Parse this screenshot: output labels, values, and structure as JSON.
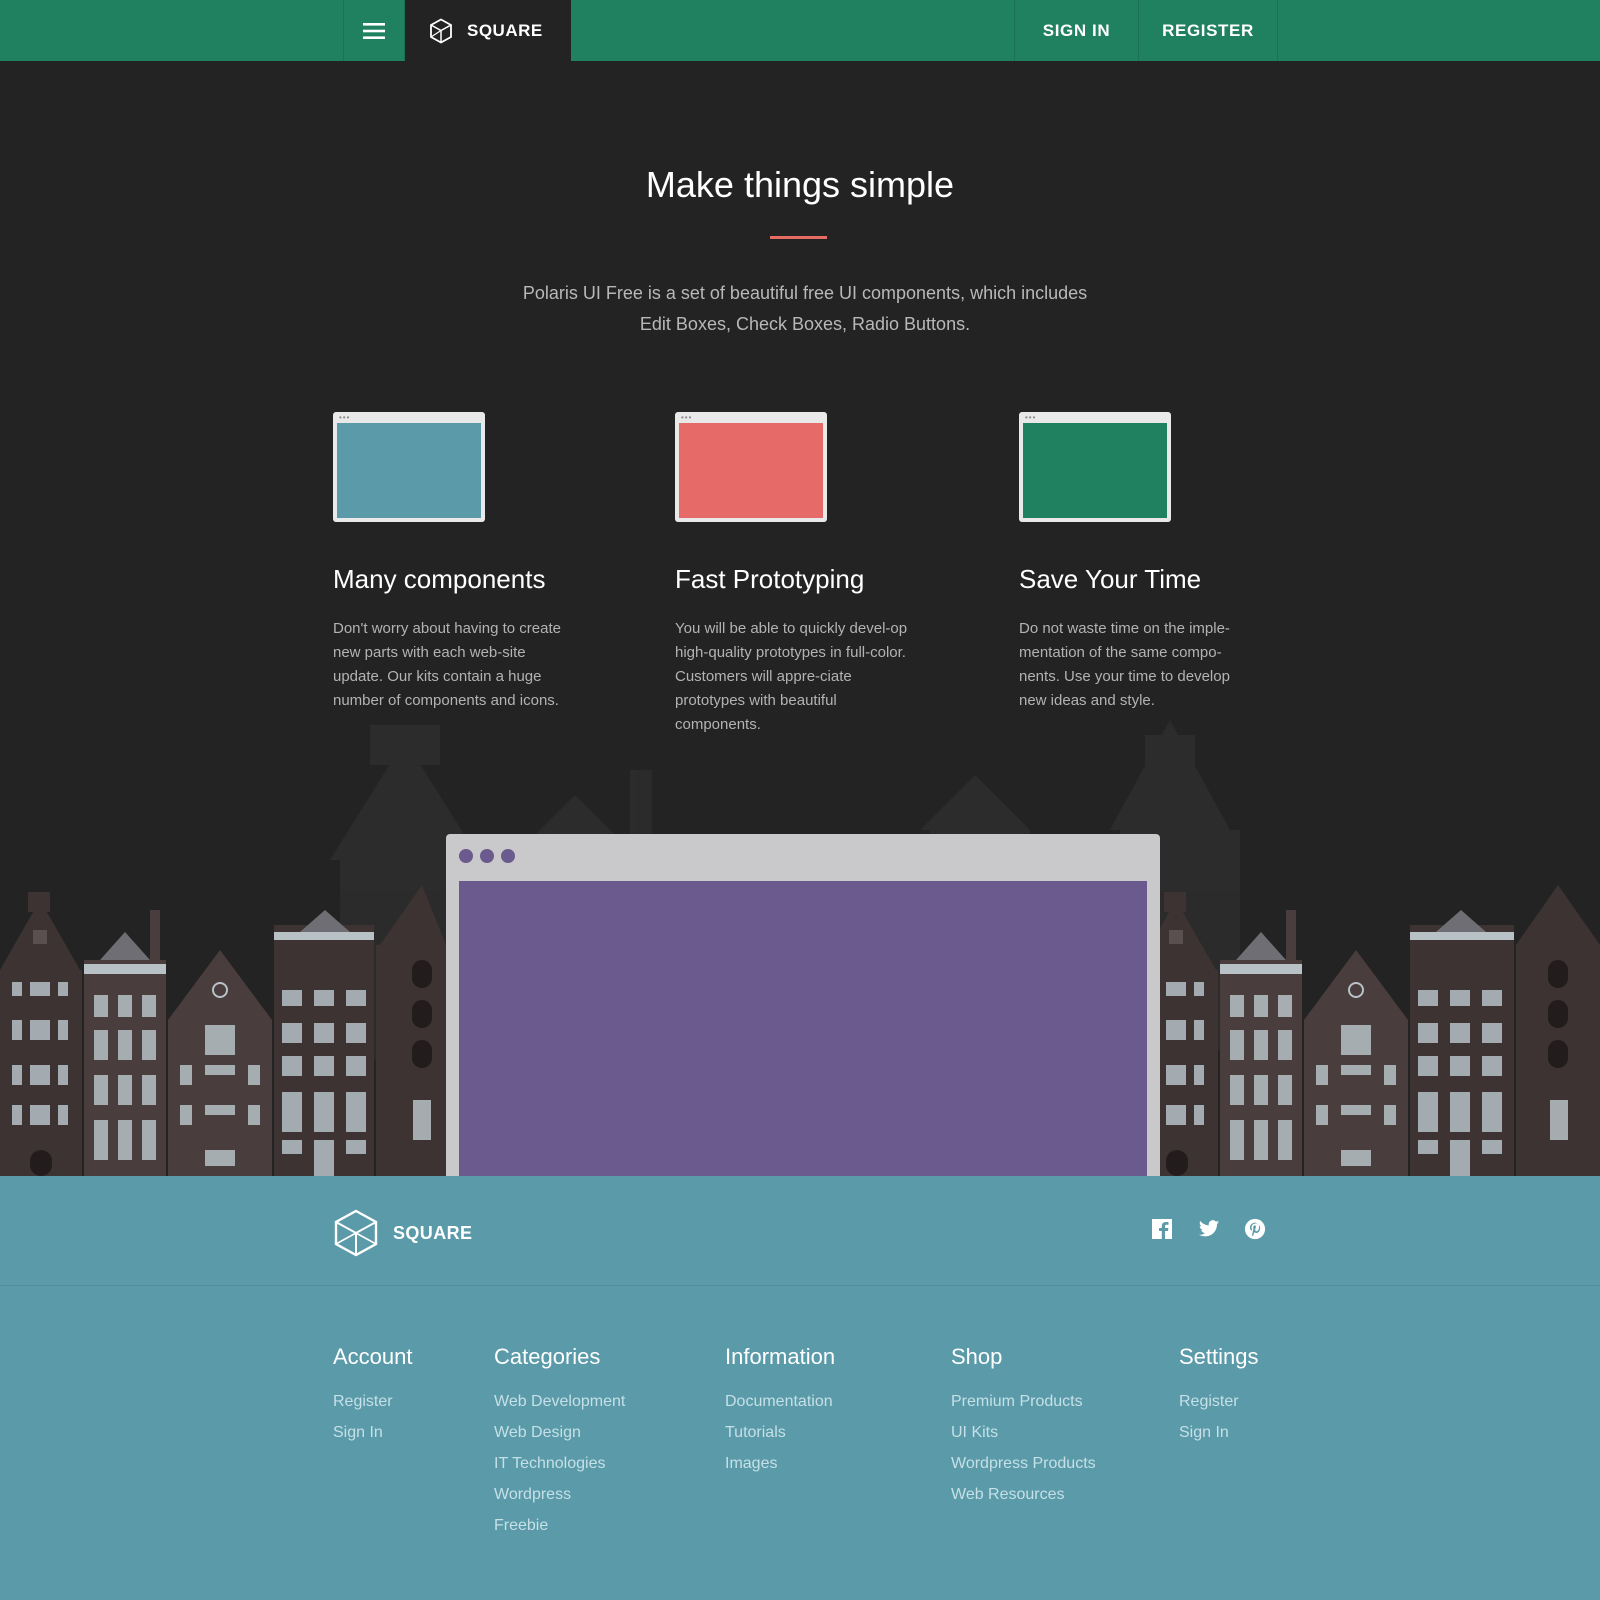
{
  "nav": {
    "brand": "SQUARE",
    "sign_in": "SIGN IN",
    "register": "REGISTER",
    "menu_icon": "hamburger-icon",
    "logo_icon": "cube-icon"
  },
  "hero": {
    "title": "Make things simple",
    "subtitle": "Polaris UI Free is a set of beautiful free UI components, which includes Edit Boxes, Check Boxes, Radio Buttons."
  },
  "features": [
    {
      "title": "Many components",
      "text": "Don't worry about having to create new parts with each web-site update. Our kits contain a huge number of components and icons.",
      "color": "#5a9aa9"
    },
    {
      "title": "Fast Prototyping",
      "text": "You will be able to quickly devel-op high-quality prototypes in full-color. Customers will appre-ciate prototypes with beautiful components.",
      "color": "#e66b68"
    },
    {
      "title": "Save Your Time",
      "text": "Do not waste time on the imple-mentation of the same compo-nents. Use your time to develop new ideas and style.",
      "color": "#1f8160"
    }
  ],
  "browser": {
    "color": "#6b5a8e"
  },
  "footer": {
    "brand": "SQUARE",
    "social": [
      "facebook-icon",
      "twitter-icon",
      "pinterest-icon"
    ],
    "columns": [
      {
        "title": "Account",
        "links": [
          "Register",
          "Sign In"
        ]
      },
      {
        "title": "Categories",
        "links": [
          "Web Development",
          "Web Design",
          "IT Technologies",
          "Wordpress",
          "Freebie"
        ]
      },
      {
        "title": "Information",
        "links": [
          "Documentation",
          "Tutorials",
          "Images"
        ]
      },
      {
        "title": "Shop",
        "links": [
          "Premium Products",
          "UI Kits",
          "Wordpress Products",
          "Web Resources"
        ]
      },
      {
        "title": "Settings",
        "links": [
          "Register",
          "Sign In"
        ]
      }
    ]
  },
  "colors": {
    "nav_green": "#1f8160",
    "dark_bg": "#232323",
    "accent_red": "#e66b60",
    "footer_blue": "#5a9aa9"
  }
}
